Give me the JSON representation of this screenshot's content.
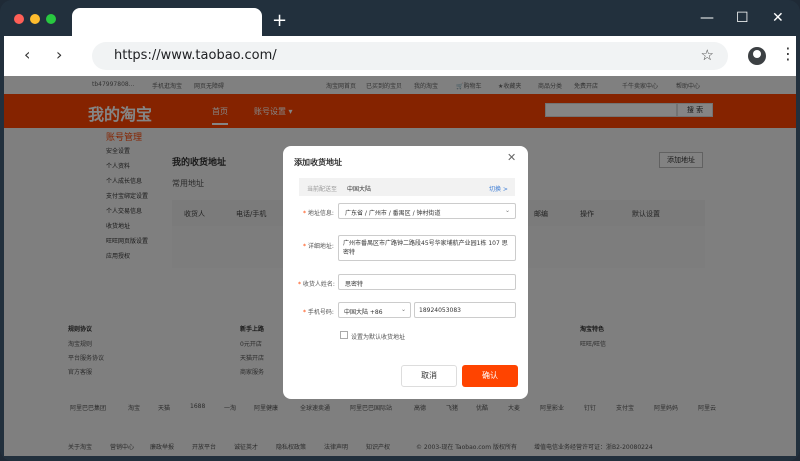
{
  "browser": {
    "url": "https://www.taobao.com/",
    "new_tab_label": "+",
    "minimize": "—",
    "maximize": "☐",
    "close": "✕",
    "back": "‹",
    "forward": "›",
    "bookmark": "☆",
    "menu": "⋮",
    "colors": {
      "red": "#ff5f57",
      "yellow": "#febc2e",
      "green": "#28c840"
    }
  },
  "topnav": {
    "user": "tb47997808...",
    "mobile": "手机逛淘宝",
    "accessibility": "网页无障碍",
    "items": [
      "淘宝网首页",
      "已买到的宝贝",
      "我的淘宝",
      "购物车",
      "收藏夹",
      "商品分类",
      "免费开店",
      "千牛卖家中心",
      "帮助中心"
    ]
  },
  "header": {
    "logo": "我的淘宝",
    "nav_home": "首页",
    "nav_account": "账号设置",
    "search_button": "搜 索",
    "brand_color": "#ff4400"
  },
  "sidebar": {
    "title": "账号管理",
    "items": [
      "安全设置",
      "个人资料",
      "个人成长信息",
      "支付宝绑定设置",
      "个人交易信息",
      "收货地址",
      "旺旺网页版设置",
      "应用授权"
    ]
  },
  "main": {
    "title": "我的收货地址",
    "add_address": "添加地址",
    "common_label": "常用地址",
    "columns": [
      "收货人",
      "电话/手机",
      "邮编",
      "操作",
      "默认设置"
    ]
  },
  "footer": {
    "col1_title": "规则协议",
    "col1_items": [
      "淘宝规则",
      "平台服务协议",
      "官方客服"
    ],
    "col2_title": "新手上路",
    "col2_items": [
      "0元开店",
      "天猫开店",
      "商家服务"
    ],
    "col3_title": "淘宝特色",
    "col3_items": [
      "旺旺/旺信"
    ],
    "links": [
      "阿里巴巴集团",
      "淘宝",
      "天猫",
      "1688",
      "一淘",
      "阿里健康",
      "全球速卖通",
      "阿里巴巴国际站",
      "高德",
      "飞猪",
      "优酷",
      "大麦",
      "阿里影业",
      "钉钉",
      "支付宝",
      "阿里妈妈",
      "阿里云"
    ],
    "bottom": [
      "关于淘宝",
      "营销中心",
      "廉政举报",
      "开放平台",
      "诚征英才",
      "隐私权政策",
      "法律声明",
      "知识产权"
    ],
    "copyright": "© 2003-现在 Taobao.com 版权所有",
    "license": "增值电信业务经营许可证：浙B2-20080224"
  },
  "modal": {
    "title": "添加收货地址",
    "close": "✕",
    "deliver_label": "当前配送至",
    "deliver_value": "中国大陆",
    "switch": "切换 >",
    "region_label": "地址信息:",
    "region_value": "广东省 / 广州市 / 番禺区 / 钟村街道",
    "detail_label": "详细地址:",
    "detail_value": "广州市番禺区市广路钟二路段45号华家埔航产业园1栋 107 思密特",
    "name_label": "收货人姓名:",
    "name_value": "思密特",
    "phone_label": "手机号码:",
    "phone_region": "中国大陆 +86",
    "phone_value": "18924053083",
    "default_label": "设置为默认收货地址",
    "cancel": "取消",
    "confirm": "确认"
  }
}
